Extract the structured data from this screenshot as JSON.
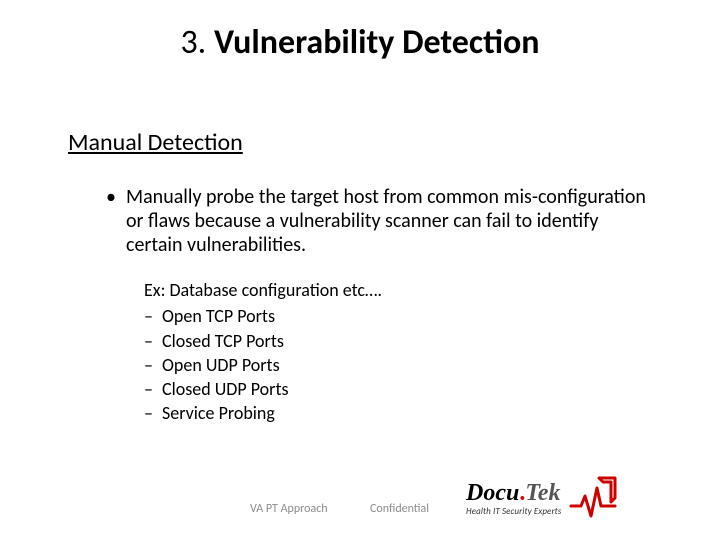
{
  "title": {
    "number": "3.",
    "text": "Vulnerability Detection"
  },
  "subheading": "Manual Detection",
  "bullet": "Manually probe the target host from common mis-configuration or flaws because a vulnerability scanner can fail to identify certain vulnerabilities.",
  "example_label": "Ex: Database configuration etc….",
  "items": [
    "Open TCP Ports",
    "Closed TCP Ports",
    "Open UDP Ports",
    "Closed UDP Ports",
    "Service Probing"
  ],
  "footer": {
    "left": "VA PT Approach",
    "mid": "Confidential"
  },
  "logo": {
    "part1": "Docu",
    "dot": ".",
    "part2": "Tek",
    "tagline": "Health IT Security Experts"
  }
}
